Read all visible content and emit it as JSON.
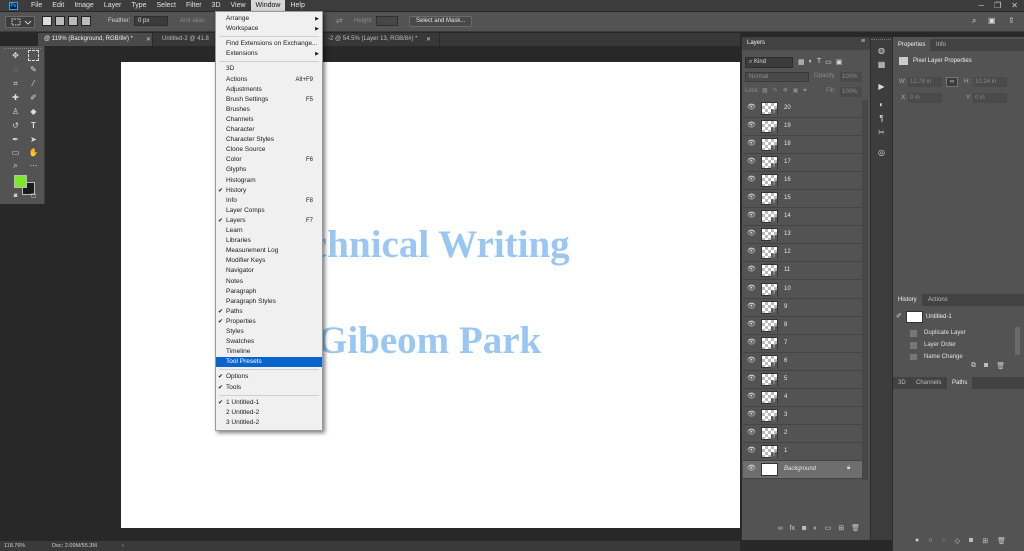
{
  "menubar": {
    "app_badge": "Ps",
    "items": [
      "File",
      "Edit",
      "Image",
      "Layer",
      "Type",
      "Select",
      "Filter",
      "3D",
      "View",
      "Window",
      "Help"
    ],
    "open_item": "Window"
  },
  "options_bar": {
    "feather_label": "Feather:",
    "feather_value": "0 px",
    "antialias_label": "Anti-alias",
    "height_label": "Height:",
    "select_mask_label": "Select and Mask..."
  },
  "tabs": [
    {
      "label": "@ 119% (Background, RGB/8#) *",
      "active": true
    },
    {
      "label": "Untitled-2 @ 41.8",
      "active": false
    },
    {
      "label": "-2 @ 54.5% (Layer 13, RGB/8#) *",
      "active": false
    }
  ],
  "document": {
    "line1": "chnical Writing",
    "line2": "Gibeom Park"
  },
  "status": {
    "zoom": "118.76%",
    "doc_info": "Doc: 2.09M/55.3M"
  },
  "window_menu": {
    "items": [
      {
        "label": "Arrange",
        "submenu": true
      },
      {
        "label": "Workspace",
        "submenu": true
      },
      {
        "sep": true
      },
      {
        "label": "Find Extensions on Exchange..."
      },
      {
        "label": "Extensions",
        "submenu": true
      },
      {
        "sep": true
      },
      {
        "label": "3D"
      },
      {
        "label": "Actions",
        "shortcut": "Alt+F9"
      },
      {
        "label": "Adjustments"
      },
      {
        "label": "Brush Settings",
        "shortcut": "F5"
      },
      {
        "label": "Brushes"
      },
      {
        "label": "Channels"
      },
      {
        "label": "Character"
      },
      {
        "label": "Character Styles"
      },
      {
        "label": "Clone Source"
      },
      {
        "label": "Color",
        "shortcut": "F6"
      },
      {
        "label": "Glyphs"
      },
      {
        "label": "Histogram"
      },
      {
        "label": "History",
        "checked": true
      },
      {
        "label": "Info",
        "shortcut": "F8"
      },
      {
        "label": "Layer Comps"
      },
      {
        "label": "Layers",
        "shortcut": "F7",
        "checked": true
      },
      {
        "label": "Learn"
      },
      {
        "label": "Libraries"
      },
      {
        "label": "Measurement Log"
      },
      {
        "label": "Modifier Keys"
      },
      {
        "label": "Navigator"
      },
      {
        "label": "Notes"
      },
      {
        "label": "Paragraph"
      },
      {
        "label": "Paragraph Styles"
      },
      {
        "label": "Paths",
        "checked": true
      },
      {
        "label": "Properties",
        "checked": true
      },
      {
        "label": "Styles"
      },
      {
        "label": "Swatches"
      },
      {
        "label": "Timeline"
      },
      {
        "label": "Tool Presets",
        "highlighted": true
      },
      {
        "sep": true
      },
      {
        "label": "Options",
        "checked": true
      },
      {
        "label": "Tools",
        "checked": true
      },
      {
        "sep": true
      },
      {
        "label": "1 Untitled-1",
        "checked": true
      },
      {
        "label": "2 Untitled-2"
      },
      {
        "label": "3 Untitled-2"
      }
    ]
  },
  "layers_panel": {
    "title": "Layers",
    "kind_label": "Kind",
    "blend_mode": "Normal",
    "opacity_label": "Opacity:",
    "opacity_value": "100%",
    "lock_label": "Lock:",
    "fill_label": "Fill:",
    "fill_value": "100%",
    "layers": [
      "20",
      "19",
      "18",
      "17",
      "16",
      "15",
      "14",
      "13",
      "12",
      "11",
      "10",
      "9",
      "8",
      "7",
      "6",
      "5",
      "4",
      "3",
      "2",
      "1"
    ],
    "background_label": "Background"
  },
  "properties_panel": {
    "tabs": [
      "Properties",
      "Info"
    ],
    "title": "Pixel Layer Properties",
    "w_label": "W:",
    "w_value": "12.78 in",
    "h_label": "H:",
    "h_value": "10.24 in",
    "x_label": "X:",
    "x_value": "0 in",
    "y_label": "Y:",
    "y_value": "0 in"
  },
  "history_panel": {
    "tabs": [
      "History",
      "Actions"
    ],
    "snapshot": "Untitled-1",
    "states": [
      "Duplicate Layer",
      "Layer Order",
      "Name Change"
    ]
  },
  "paths_panel": {
    "tabs": [
      "3D",
      "Channels",
      "Paths"
    ]
  },
  "colors": {
    "foreground": "#7de52e",
    "background": "#1a1a1a",
    "doc_text": "#99c6f3",
    "menu_highlight": "#0a64ce"
  }
}
